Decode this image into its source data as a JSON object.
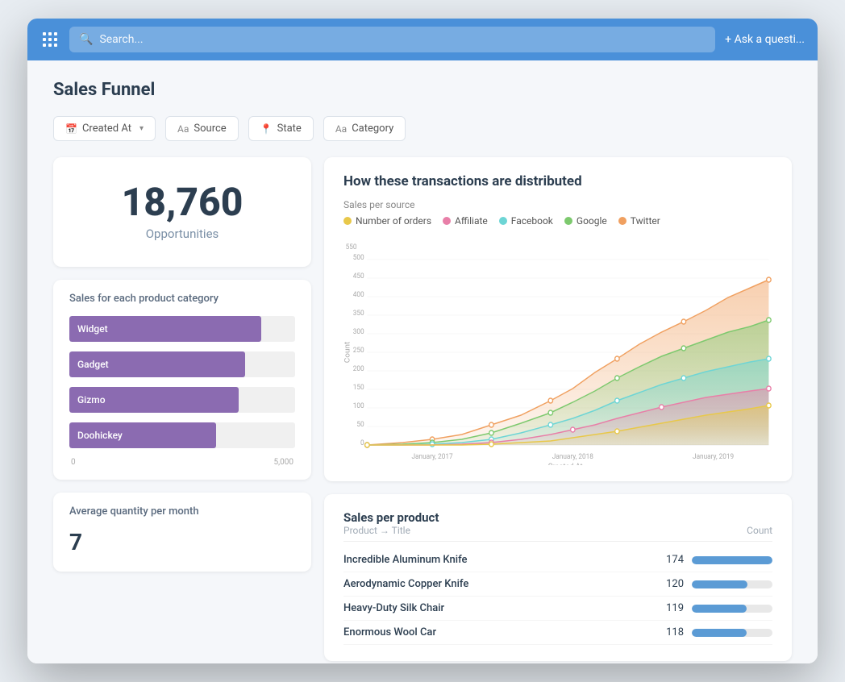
{
  "topbar": {
    "search_placeholder": "Search...",
    "ask_question_label": "+ Ask a questi..."
  },
  "page": {
    "title": "Sales Funnel"
  },
  "filters": [
    {
      "id": "created-at",
      "icon": "calendar",
      "label": "Created At",
      "has_dropdown": true
    },
    {
      "id": "source",
      "icon": "text",
      "label": "Source",
      "has_dropdown": false
    },
    {
      "id": "state",
      "icon": "pin",
      "label": "State",
      "has_dropdown": false
    },
    {
      "id": "category",
      "icon": "text",
      "label": "Category",
      "has_dropdown": false
    }
  ],
  "opportunities": {
    "number": "18,760",
    "label": "Opportunities"
  },
  "category_chart": {
    "title": "Sales for each product category",
    "bars": [
      {
        "label": "Widget",
        "pct": 85,
        "color": "#8b6bb1"
      },
      {
        "label": "Gadget",
        "pct": 78,
        "color": "#8b6bb1"
      },
      {
        "label": "Gizmo",
        "pct": 75,
        "color": "#8b6bb1"
      },
      {
        "label": "Doohickey",
        "pct": 65,
        "color": "#8b6bb1"
      }
    ],
    "axis": {
      "min": "0",
      "max": "5,000"
    }
  },
  "avg_qty": {
    "title": "Average quantity per month",
    "value": "7"
  },
  "distribution": {
    "title": "How these transactions are distributed",
    "subtitle": "Sales per source",
    "legend": [
      {
        "label": "Number of orders",
        "color": "#e8c84a"
      },
      {
        "label": "Affiliate",
        "color": "#e87fa8"
      },
      {
        "label": "Facebook",
        "color": "#6dd5d5"
      },
      {
        "label": "Google",
        "color": "#7dc96e"
      },
      {
        "label": "Twitter",
        "color": "#f0a060"
      }
    ],
    "y_label": "Count",
    "x_label": "Created At",
    "x_ticks": [
      "January, 2017",
      "January, 2018",
      "January, 2019"
    ],
    "y_ticks": [
      "0",
      "50",
      "100",
      "150",
      "200",
      "250",
      "300",
      "350",
      "400",
      "450",
      "500",
      "550"
    ]
  },
  "products": {
    "title": "Sales per product",
    "col_product": "Product → Title",
    "col_count": "Count",
    "rows": [
      {
        "name": "Incredible Aluminum Knife",
        "count": 174,
        "pct": 100
      },
      {
        "name": "Aerodynamic Copper Knife",
        "count": 120,
        "pct": 69
      },
      {
        "name": "Heavy-Duty Silk Chair",
        "count": 119,
        "pct": 68
      },
      {
        "name": "Enormous Wool Car",
        "count": 118,
        "pct": 68
      }
    ]
  }
}
